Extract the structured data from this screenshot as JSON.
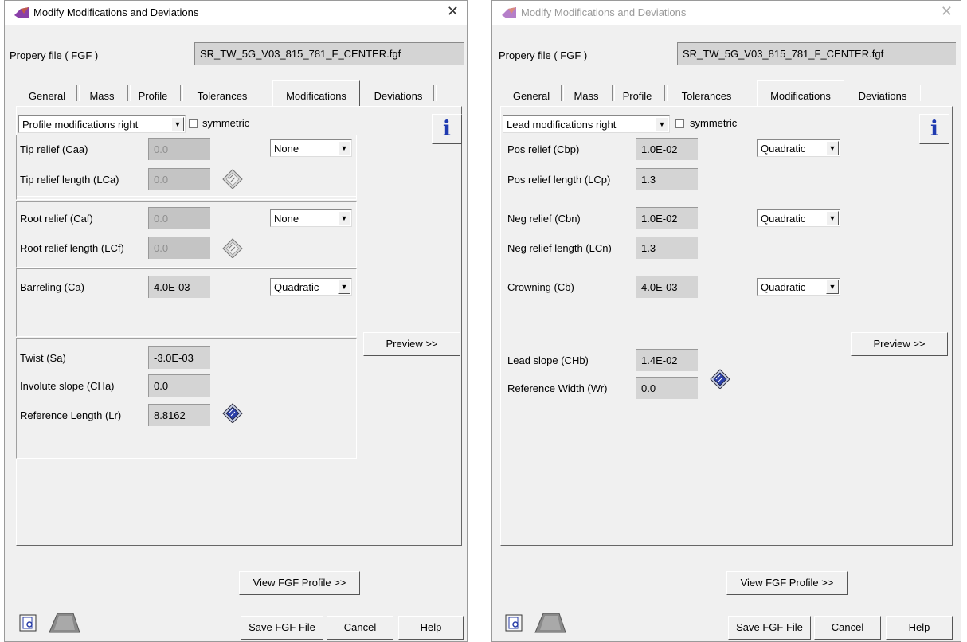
{
  "left": {
    "title": "Modify Modifications and Deviations",
    "propfile_label": "Propery file ( FGF )",
    "propfile_value": "SR_TW_5G_V03_815_781_F_CENTER.fgf",
    "tabs": [
      "General",
      "Mass",
      "Profile",
      "Tolerances",
      "Modifications",
      "Deviations"
    ],
    "mod_type": "Profile modifications right",
    "symmetric_label": "symmetric",
    "info": "i",
    "rows": {
      "tip_relief_label": "Tip relief (Caa)",
      "tip_relief_value": "0.0",
      "tip_relief_type": "None",
      "tip_relief_length_label": "Tip relief length (LCa)",
      "tip_relief_length_value": "0.0",
      "root_relief_label": "Root relief (Caf)",
      "root_relief_value": "0.0",
      "root_relief_type": "None",
      "root_relief_length_label": "Root relief length (LCf)",
      "root_relief_length_value": "0.0",
      "barreling_label": "Barreling (Ca)",
      "barreling_value": "4.0E-03",
      "barreling_type": "Quadratic",
      "twist_label": "Twist (Sa)",
      "twist_value": "-3.0E-03",
      "involute_slope_label": "Involute slope (CHa)",
      "involute_slope_value": "0.0",
      "ref_length_label": "Reference Length (Lr)",
      "ref_length_value": "8.8162"
    },
    "preview": "Preview >>",
    "view_profile": "View FGF Profile >>",
    "save": "Save FGF File",
    "cancel": "Cancel",
    "help": "Help"
  },
  "right": {
    "title": "Modify Modifications and Deviations",
    "propfile_label": "Propery file ( FGF )",
    "propfile_value": "SR_TW_5G_V03_815_781_F_CENTER.fgf",
    "tabs": [
      "General",
      "Mass",
      "Profile",
      "Tolerances",
      "Modifications",
      "Deviations"
    ],
    "mod_type": "Lead modifications right",
    "symmetric_label": "symmetric",
    "info": "i",
    "rows": {
      "pos_relief_label": "Pos relief (Cbp)",
      "pos_relief_value": "1.0E-02",
      "pos_relief_type": "Quadratic",
      "pos_relief_length_label": "Pos relief length (LCp)",
      "pos_relief_length_value": "1.3",
      "neg_relief_label": "Neg relief (Cbn)",
      "neg_relief_value": "1.0E-02",
      "neg_relief_type": "Quadratic",
      "neg_relief_length_label": "Neg relief length (LCn)",
      "neg_relief_length_value": "1.3",
      "crowning_label": "Crowning (Cb)",
      "crowning_value": "4.0E-03",
      "crowning_type": "Quadratic",
      "lead_slope_label": "Lead slope (CHb)",
      "lead_slope_value": "1.4E-02",
      "ref_width_label": "Reference Width (Wr)",
      "ref_width_value": "0.0"
    },
    "preview": "Preview >>",
    "view_profile": "View FGF Profile >>",
    "save": "Save FGF File",
    "cancel": "Cancel",
    "help": "Help"
  },
  "colors": {
    "window_bg": "#f0f0f0",
    "field_bg": "#d4d4d4",
    "info_blue": "#1f3ab0",
    "title_icon": "#8a3fa8"
  },
  "icons": [
    "app-logo-icon",
    "close-icon",
    "dropdown-arrow-icon",
    "calculator-icon",
    "info-icon",
    "document-icon",
    "gear-blank-icon"
  ]
}
